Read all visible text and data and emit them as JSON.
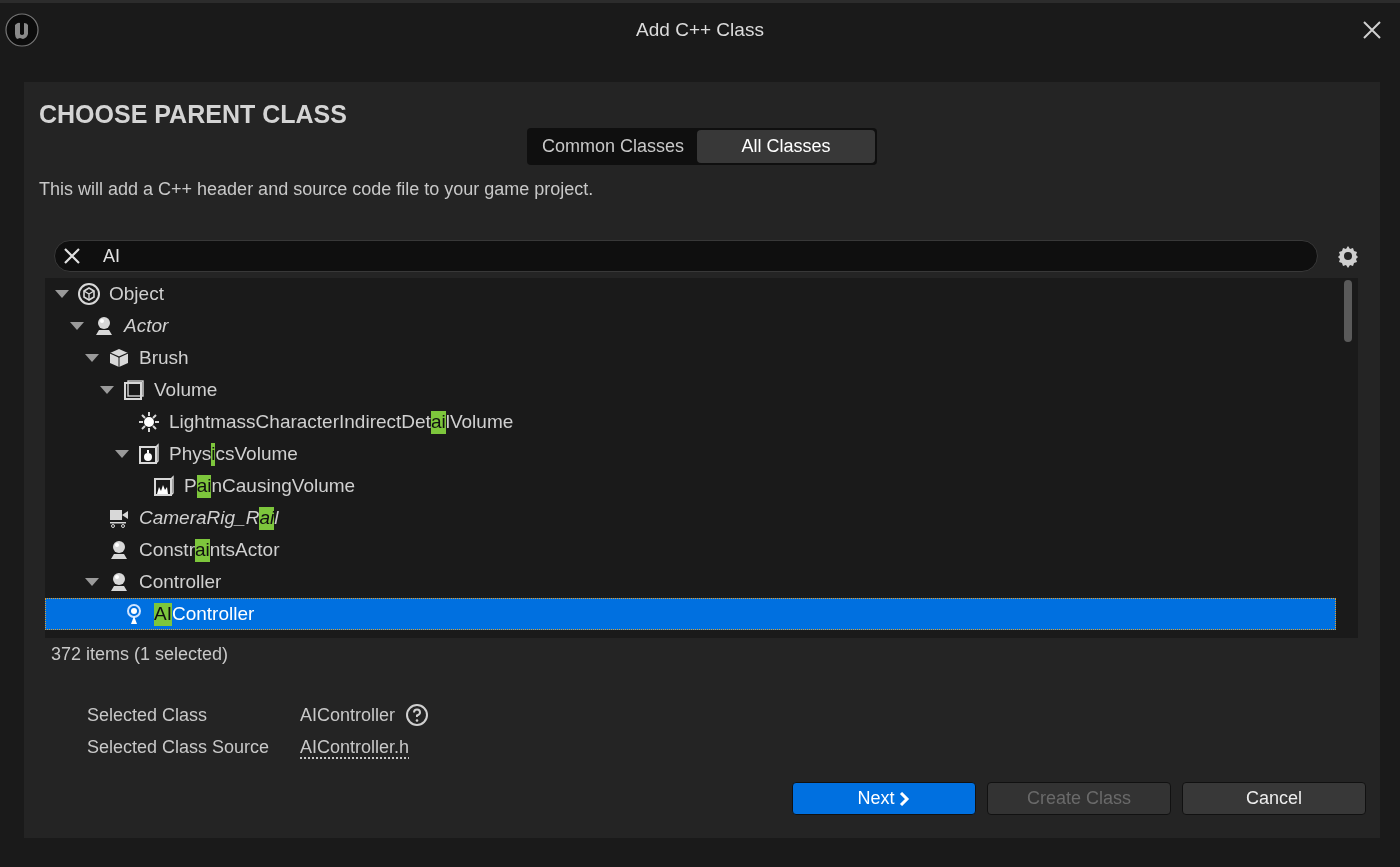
{
  "window": {
    "title": "Add C++ Class"
  },
  "heading": "CHOOSE PARENT CLASS",
  "tabs": [
    {
      "label": "Common Classes",
      "selected": false
    },
    {
      "label": "All Classes",
      "selected": true
    }
  ],
  "description": "This will add a C++ header and source code file to your game project.",
  "search": {
    "value": "AI"
  },
  "tree": [
    {
      "kind": "object",
      "parts": [
        {
          "text": "Object",
          "match": false
        }
      ],
      "italic": false,
      "selected": false,
      "expanded": true,
      "children": [
        {
          "kind": "actor",
          "parts": [
            {
              "text": "Actor",
              "match": false
            }
          ],
          "italic": true,
          "selected": false,
          "expanded": true,
          "children": [
            {
              "kind": "brush",
              "parts": [
                {
                  "text": "Brush",
                  "match": false
                }
              ],
              "italic": false,
              "selected": false,
              "expanded": true,
              "children": [
                {
                  "kind": "volume",
                  "parts": [
                    {
                      "text": "Volume",
                      "match": false
                    }
                  ],
                  "italic": false,
                  "selected": false,
                  "expanded": true,
                  "children": [
                    {
                      "kind": "light",
                      "parts": [
                        {
                          "text": "LightmassCharacterIndirectDet",
                          "match": false
                        },
                        {
                          "text": "ai",
                          "match": true
                        },
                        {
                          "text": "lVolume",
                          "match": false
                        }
                      ],
                      "italic": false,
                      "selected": false
                    },
                    {
                      "kind": "physics",
                      "parts": [
                        {
                          "text": "Phys",
                          "match": false
                        },
                        {
                          "text": "i",
                          "match": true
                        },
                        {
                          "text": "csVolume",
                          "match": false
                        }
                      ],
                      "italic": false,
                      "selected": false,
                      "expanded": true,
                      "children": [
                        {
                          "kind": "pain",
                          "parts": [
                            {
                              "text": "P",
                              "match": false
                            },
                            {
                              "text": "ai",
                              "match": true
                            },
                            {
                              "text": "nCausingVolume",
                              "match": false
                            }
                          ],
                          "italic": false,
                          "selected": false
                        }
                      ]
                    }
                  ]
                }
              ]
            },
            {
              "kind": "camera",
              "parts": [
                {
                  "text": "CameraRig_R",
                  "match": false
                },
                {
                  "text": "ai",
                  "match": true
                },
                {
                  "text": "l",
                  "match": false
                }
              ],
              "italic": true,
              "selected": false
            },
            {
              "kind": "actor",
              "parts": [
                {
                  "text": "Constr",
                  "match": false
                },
                {
                  "text": "ai",
                  "match": true
                },
                {
                  "text": "ntsActor",
                  "match": false
                }
              ],
              "italic": false,
              "selected": false
            },
            {
              "kind": "actor",
              "parts": [
                {
                  "text": "Controller",
                  "match": false
                }
              ],
              "italic": false,
              "selected": false,
              "expanded": true,
              "children": [
                {
                  "kind": "ai",
                  "parts": [
                    {
                      "text": "AI",
                      "match": true
                    },
                    {
                      "text": "Controller",
                      "match": false
                    }
                  ],
                  "italic": false,
                  "selected": true
                }
              ]
            }
          ]
        }
      ]
    }
  ],
  "item_count": "372 items (1 selected)",
  "details": [
    {
      "label": "Selected Class",
      "value": "AIController",
      "kind": "help"
    },
    {
      "label": "Selected Class Source",
      "value": "AIController.h",
      "kind": "link"
    }
  ],
  "buttons": [
    {
      "label": "Next",
      "kind": "primary",
      "disabled": false
    },
    {
      "label": "Create Class",
      "kind": "normal",
      "disabled": true
    },
    {
      "label": "Cancel",
      "kind": "normal",
      "disabled": false
    }
  ]
}
